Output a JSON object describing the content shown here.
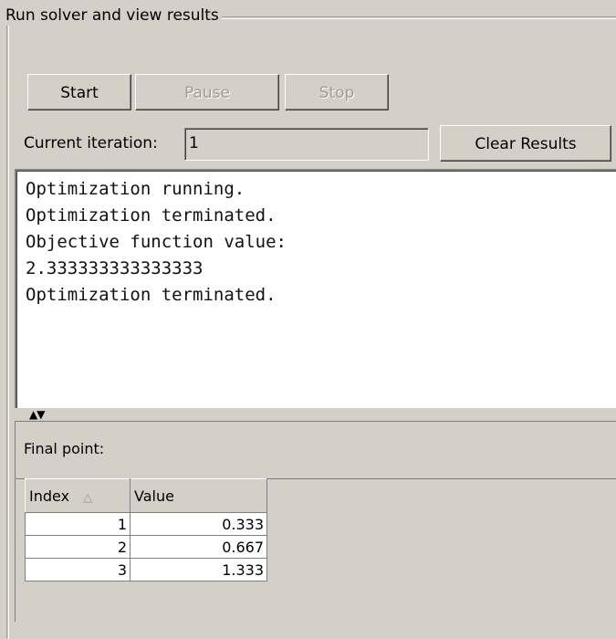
{
  "group": {
    "title": "Run solver and view results"
  },
  "buttons": {
    "start": "Start",
    "pause": "Pause",
    "stop": "Stop",
    "clear": "Clear Results"
  },
  "iteration": {
    "label": "Current iteration:",
    "value": "1"
  },
  "console": {
    "lines": [
      "Optimization running.",
      "Optimization terminated.",
      "Objective function value:",
      "2.333333333333333",
      "Optimization terminated."
    ]
  },
  "splitter": {
    "icon": "split-arrows-icon",
    "glyph": "▲▼"
  },
  "results": {
    "header": "Final point:",
    "columns": {
      "index": "Index",
      "value": "Value"
    },
    "sort_glyph": "△",
    "rows": [
      {
        "index": "1",
        "value": "0.333"
      },
      {
        "index": "2",
        "value": "0.667"
      },
      {
        "index": "3",
        "value": "1.333"
      }
    ]
  }
}
